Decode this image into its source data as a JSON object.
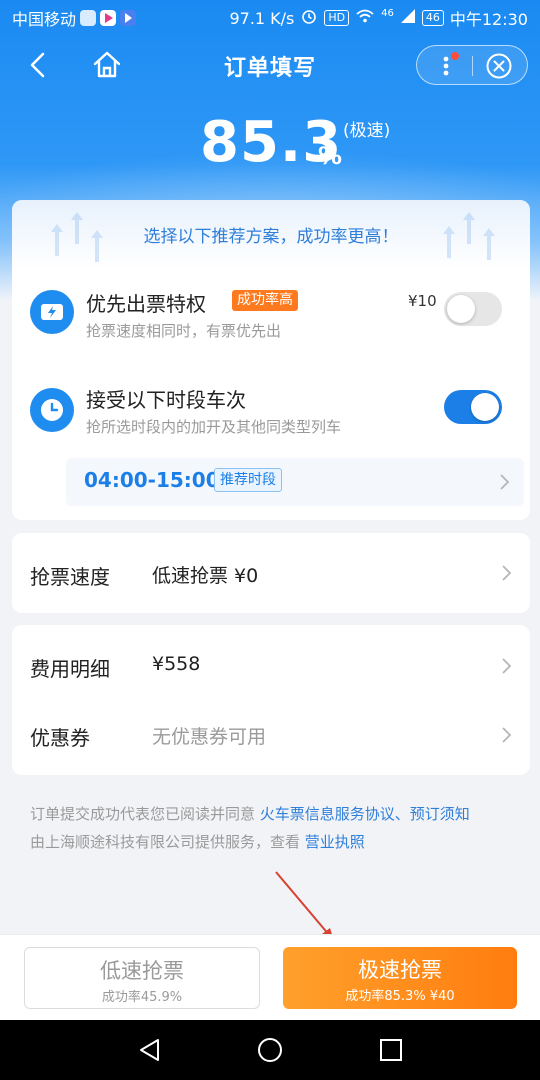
{
  "status_bar": {
    "carrier": "中国移动",
    "speed": "97.1 K/s",
    "hd": "HD",
    "signal": "46",
    "battery": "46",
    "time": "中午12:30"
  },
  "nav": {
    "title": "订单填写"
  },
  "rate": {
    "value": "85.3",
    "unit": "%",
    "tag": "(极速)"
  },
  "recommend": {
    "banner": "选择以下推荐方案，成功率更高！",
    "priority": {
      "title": "优先出票特权",
      "tag": "成功率高",
      "desc": "抢票速度相同时，有票优先出",
      "price": "¥10",
      "enabled": false
    },
    "period": {
      "title": "接受以下时段车次",
      "desc": "抢所选时段内的加开及其他同类型列车",
      "enabled": true,
      "time_range": "04:00-15:00",
      "time_tag": "推荐时段"
    }
  },
  "speed_row": {
    "label": "抢票速度",
    "value": "低速抢票  ¥0"
  },
  "fee_row": {
    "label": "费用明细",
    "value": "¥558"
  },
  "coupon_row": {
    "label": "优惠券",
    "value": "无优惠券可用"
  },
  "legal": {
    "line1_prefix": "订单提交成功代表您已阅读并同意 ",
    "link1": "火车票信息服务协议、预订须知",
    "line2_prefix": "由上海顺途科技有限公司提供服务，查看 ",
    "link2": "营业执照"
  },
  "bottom": {
    "slow_label": "低速抢票",
    "slow_sub": "成功率45.9%",
    "fast_label": "极速抢票",
    "fast_sub": "成功率85.3% ¥40"
  },
  "colors": {
    "primary": "#1c7fe8",
    "accent_orange": "#ff7d0f",
    "tag_orange": "#ff7a1f"
  }
}
